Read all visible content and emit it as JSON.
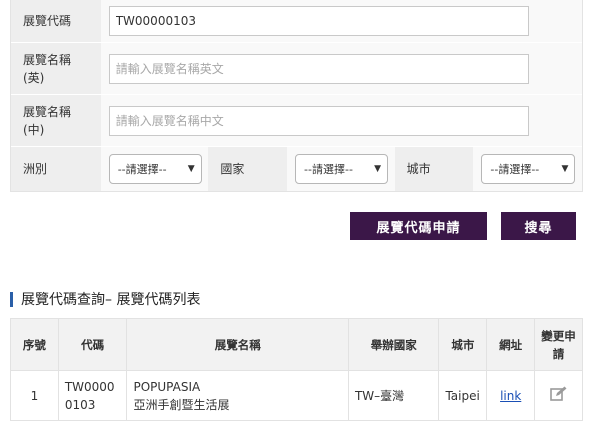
{
  "form": {
    "code_label": "展覽代碼",
    "code_value": "TW00000103",
    "name_en_label_line1": "展覽名稱",
    "name_en_label_line2": "(英)",
    "name_en_placeholder": "請輸入展覽名稱英文",
    "name_zh_label_line1": "展覽名稱",
    "name_zh_label_line2": "(中)",
    "name_zh_placeholder": "請輸入展覽名稱中文",
    "continent_label": "洲別",
    "continent_value": "--請選擇--",
    "country_label": "國家",
    "country_value": "--請選擇--",
    "city_label": "城市",
    "city_value": "--請選擇--"
  },
  "buttons": {
    "apply_code": "展覽代碼申請",
    "search": "搜尋"
  },
  "section": {
    "title": "展覽代碼查詢– 展覽代碼列表"
  },
  "table": {
    "headers": {
      "no": "序號",
      "code": "代碼",
      "name": "展覽名稱",
      "country": "舉辦國家",
      "city": "城市",
      "url": "網址",
      "edit": "變更申請"
    },
    "rows": [
      {
        "no": "1",
        "code": "TW00000103",
        "name_en": "POPUPASIA",
        "name_zh": "亞洲手創暨生活展",
        "country": "TW–臺灣",
        "city": "Taipei",
        "url": "link",
        "edit_icon": "edit-icon"
      }
    ]
  },
  "colors": {
    "button_bg": "#3b1748",
    "label_bg": "#eeeeee",
    "section_bar": "#2a5fa8",
    "link": "#1a4fb5"
  }
}
